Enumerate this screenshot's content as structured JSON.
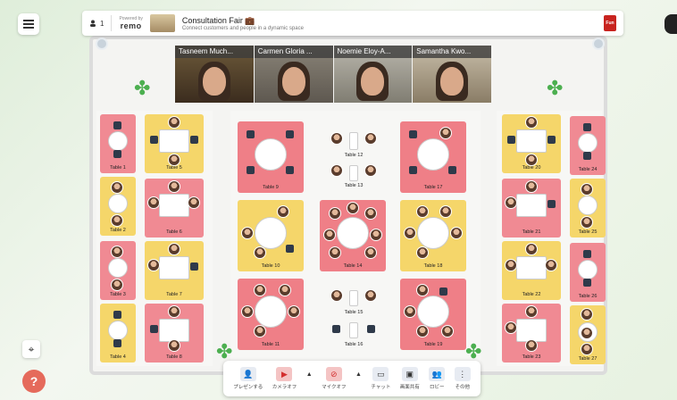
{
  "header": {
    "user_count": "1",
    "powered_by": "Powered by",
    "brand": "remo",
    "event_title": "Consultation Fair 💼",
    "event_subtitle": "Connect customers and people in a dynamic space",
    "logo_text": "Fun"
  },
  "videos": [
    {
      "name": "Tasneem Much..."
    },
    {
      "name": "Carmen Gloria ..."
    },
    {
      "name": "Noemie Eloy-A..."
    },
    {
      "name": "Samantha Kwo..."
    }
  ],
  "tables": [
    {
      "label": "Table 1"
    },
    {
      "label": "Table 2"
    },
    {
      "label": "Table 3"
    },
    {
      "label": "Table 4"
    },
    {
      "label": "Table 5"
    },
    {
      "label": "Table 6"
    },
    {
      "label": "Table 7"
    },
    {
      "label": "Table 8"
    },
    {
      "label": "Table 9"
    },
    {
      "label": "Table 10"
    },
    {
      "label": "Table 11"
    },
    {
      "label": "Table 12"
    },
    {
      "label": "Table 13"
    },
    {
      "label": "Table 14"
    },
    {
      "label": "Table 15"
    },
    {
      "label": "Table 16"
    },
    {
      "label": "Table 17"
    },
    {
      "label": "Table 18"
    },
    {
      "label": "Table 19"
    },
    {
      "label": "Table 20"
    },
    {
      "label": "Table 21"
    },
    {
      "label": "Table 22"
    },
    {
      "label": "Table 23"
    },
    {
      "label": "Table 24"
    },
    {
      "label": "Table 25"
    },
    {
      "label": "Table 26"
    },
    {
      "label": "Table 27"
    }
  ],
  "toolbar": {
    "present": "プレゼンする",
    "camera": "カメラオフ",
    "mic": "マイクオフ",
    "chat": "チャット",
    "screen_share": "画面共有",
    "lobby": "ロビー",
    "more": "その他"
  },
  "colors": {
    "pink": "#f08a93",
    "yellow": "#f5d66a",
    "help": "#e56a5b"
  }
}
